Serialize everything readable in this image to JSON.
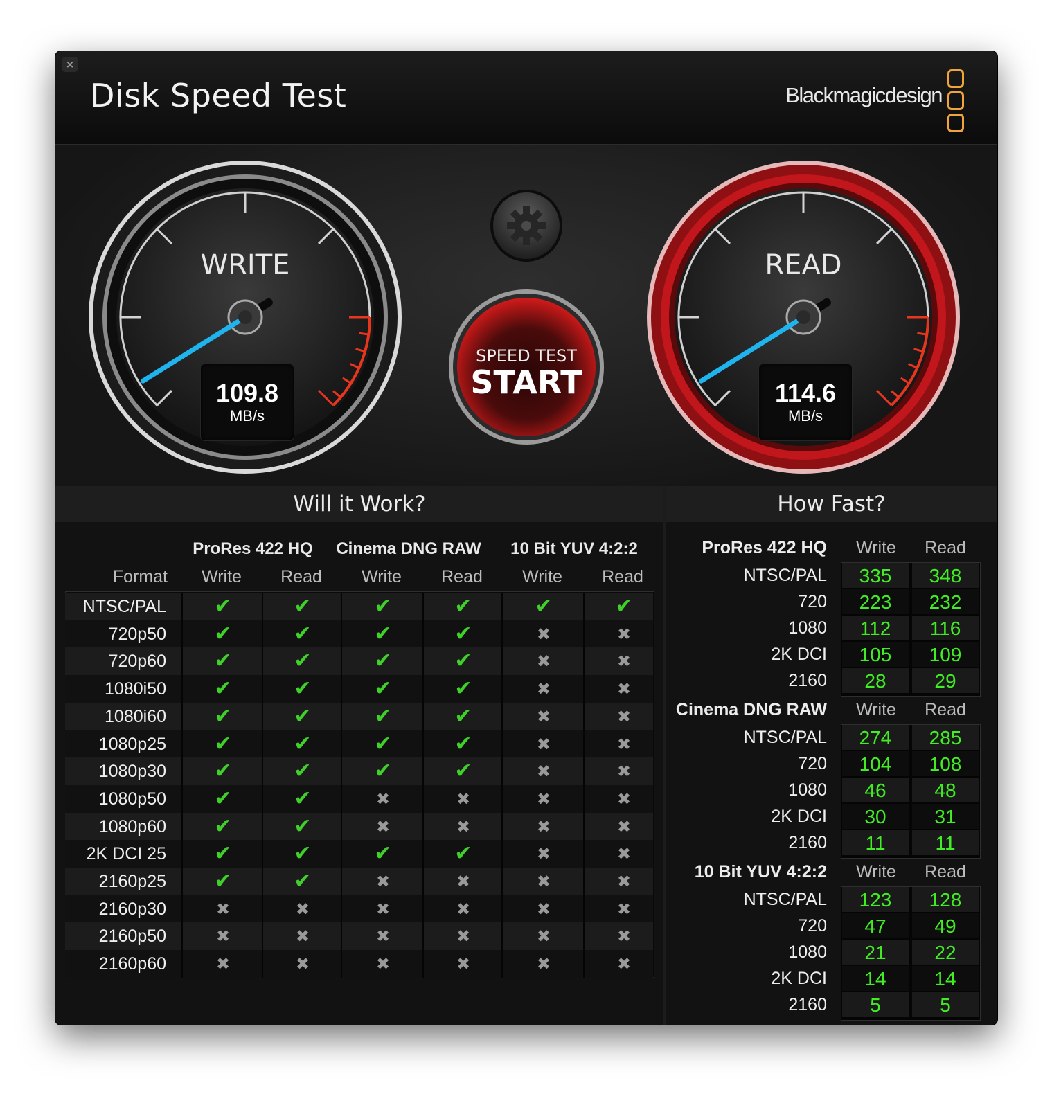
{
  "window": {
    "title": "Disk Speed Test",
    "brand": "Blackmagicdesign",
    "close_icon": "close-icon"
  },
  "gauges": {
    "write": {
      "label": "WRITE",
      "value": "109.8",
      "unit": "MB/s"
    },
    "read": {
      "label": "READ",
      "value": "114.6",
      "unit": "MB/s"
    }
  },
  "start_button": {
    "line1": "SPEED TEST",
    "line2": "START"
  },
  "settings_icon": "gear-icon",
  "will_it_work": {
    "title": "Will it Work?",
    "format_header": "Format",
    "codecs": [
      "ProRes 422 HQ",
      "Cinema DNG RAW",
      "10 Bit YUV 4:2:2"
    ],
    "write_label": "Write",
    "read_label": "Read",
    "rows": [
      {
        "format": "NTSC/PAL",
        "checks": [
          1,
          1,
          1,
          1,
          1,
          1
        ]
      },
      {
        "format": "720p50",
        "checks": [
          1,
          1,
          1,
          1,
          0,
          0
        ]
      },
      {
        "format": "720p60",
        "checks": [
          1,
          1,
          1,
          1,
          0,
          0
        ]
      },
      {
        "format": "1080i50",
        "checks": [
          1,
          1,
          1,
          1,
          0,
          0
        ]
      },
      {
        "format": "1080i60",
        "checks": [
          1,
          1,
          1,
          1,
          0,
          0
        ]
      },
      {
        "format": "1080p25",
        "checks": [
          1,
          1,
          1,
          1,
          0,
          0
        ]
      },
      {
        "format": "1080p30",
        "checks": [
          1,
          1,
          1,
          1,
          0,
          0
        ]
      },
      {
        "format": "1080p50",
        "checks": [
          1,
          1,
          0,
          0,
          0,
          0
        ]
      },
      {
        "format": "1080p60",
        "checks": [
          1,
          1,
          0,
          0,
          0,
          0
        ]
      },
      {
        "format": "2K DCI 25",
        "checks": [
          1,
          1,
          1,
          1,
          0,
          0
        ]
      },
      {
        "format": "2160p25",
        "checks": [
          1,
          1,
          0,
          0,
          0,
          0
        ]
      },
      {
        "format": "2160p30",
        "checks": [
          0,
          0,
          0,
          0,
          0,
          0
        ]
      },
      {
        "format": "2160p50",
        "checks": [
          0,
          0,
          0,
          0,
          0,
          0
        ]
      },
      {
        "format": "2160p60",
        "checks": [
          0,
          0,
          0,
          0,
          0,
          0
        ]
      }
    ]
  },
  "how_fast": {
    "title": "How Fast?",
    "write_label": "Write",
    "read_label": "Read",
    "groups": [
      {
        "codec": "ProRes 422 HQ",
        "rows": [
          {
            "label": "NTSC/PAL",
            "write": "335",
            "read": "348"
          },
          {
            "label": "720",
            "write": "223",
            "read": "232"
          },
          {
            "label": "1080",
            "write": "112",
            "read": "116"
          },
          {
            "label": "2K DCI",
            "write": "105",
            "read": "109"
          },
          {
            "label": "2160",
            "write": "28",
            "read": "29"
          }
        ]
      },
      {
        "codec": "Cinema DNG RAW",
        "rows": [
          {
            "label": "NTSC/PAL",
            "write": "274",
            "read": "285"
          },
          {
            "label": "720",
            "write": "104",
            "read": "108"
          },
          {
            "label": "1080",
            "write": "46",
            "read": "48"
          },
          {
            "label": "2K DCI",
            "write": "30",
            "read": "31"
          },
          {
            "label": "2160",
            "write": "11",
            "read": "11"
          }
        ]
      },
      {
        "codec": "10 Bit YUV 4:2:2",
        "rows": [
          {
            "label": "NTSC/PAL",
            "write": "123",
            "read": "128"
          },
          {
            "label": "720",
            "write": "47",
            "read": "49"
          },
          {
            "label": "1080",
            "write": "21",
            "read": "22"
          },
          {
            "label": "2K DCI",
            "write": "14",
            "read": "14"
          },
          {
            "label": "2160",
            "write": "5",
            "read": "5"
          }
        ]
      }
    ]
  },
  "colors": {
    "accent_green": "#41ee23",
    "needle_blue": "#1fb4ee",
    "brand_orange": "#f0a43a",
    "read_red": "#c0161c"
  }
}
